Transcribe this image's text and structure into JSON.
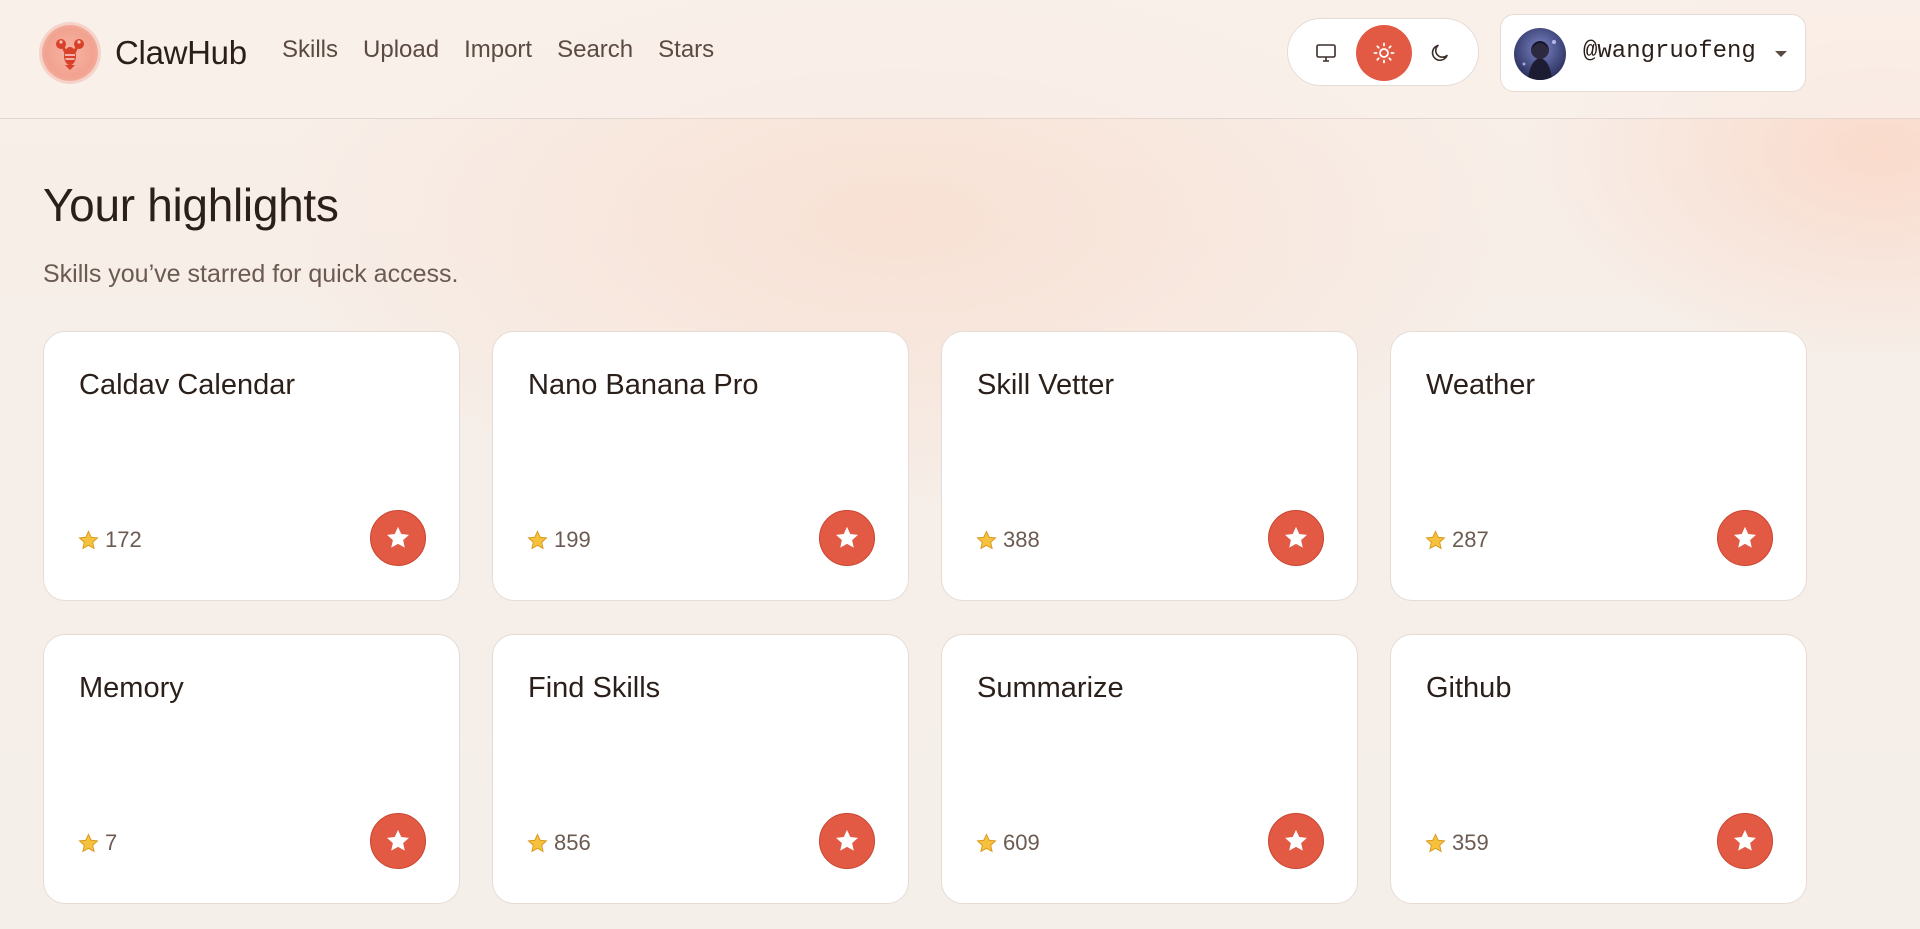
{
  "brand": {
    "name": "ClawHub"
  },
  "nav": {
    "items": [
      {
        "label": "Skills"
      },
      {
        "label": "Upload"
      },
      {
        "label": "Import"
      },
      {
        "label": "Search"
      },
      {
        "label": "Stars"
      }
    ]
  },
  "theme": {
    "options": [
      "system",
      "light",
      "dark"
    ],
    "selected": "light",
    "icons": {
      "system": "monitor-icon",
      "light": "sun-icon",
      "dark": "moon-icon"
    }
  },
  "user": {
    "handle": "@wangruofeng"
  },
  "page": {
    "title": "Your highlights",
    "subtitle": "Skills you’ve starred for quick access."
  },
  "skills": [
    {
      "name": "Caldav Calendar",
      "stars": "172"
    },
    {
      "name": "Nano Banana Pro",
      "stars": "199"
    },
    {
      "name": "Skill Vetter",
      "stars": "388"
    },
    {
      "name": "Weather",
      "stars": "287"
    },
    {
      "name": "Memory",
      "stars": "7"
    },
    {
      "name": "Find Skills",
      "stars": "856"
    },
    {
      "name": "Summarize",
      "stars": "609"
    },
    {
      "name": "Github",
      "stars": "359"
    }
  ],
  "colors": {
    "accent": "#e35a44",
    "background": "#f6eee8",
    "card": "#ffffff",
    "text": "#2b1f1a",
    "muted": "#6b5a51"
  }
}
